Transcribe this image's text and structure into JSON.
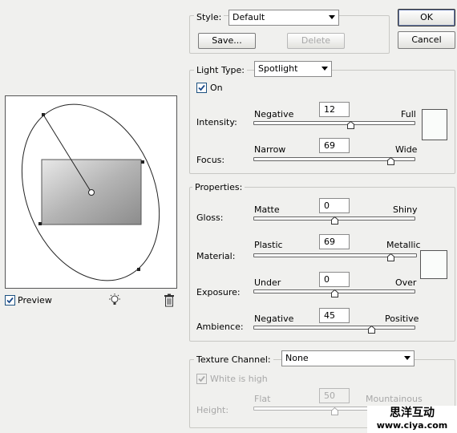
{
  "preview": {
    "checkbox_label": "Preview",
    "checked": true
  },
  "style": {
    "label": "Style:",
    "value": "Default",
    "save_label": "Save...",
    "delete_label": "Delete"
  },
  "dialog": {
    "ok_label": "OK",
    "cancel_label": "Cancel"
  },
  "light": {
    "type_label": "Light Type:",
    "type_value": "Spotlight",
    "on_label": "On",
    "on_checked": true,
    "intensity": {
      "label": "Intensity:",
      "min_label": "Negative",
      "max_label": "Full",
      "value": "12",
      "fraction": 0.6
    },
    "focus": {
      "label": "Focus:",
      "min_label": "Narrow",
      "max_label": "Wide",
      "value": "69",
      "fraction": 0.85
    }
  },
  "properties": {
    "title": "Properties:",
    "gloss": {
      "label": "Gloss:",
      "min_label": "Matte",
      "max_label": "Shiny",
      "value": "0",
      "fraction": 0.5
    },
    "material": {
      "label": "Material:",
      "min_label": "Plastic",
      "max_label": "Metallic",
      "value": "69",
      "fraction": 0.84
    },
    "exposure": {
      "label": "Exposure:",
      "min_label": "Under",
      "max_label": "Over",
      "value": "0",
      "fraction": 0.5
    },
    "ambience": {
      "label": "Ambience:",
      "min_label": "Negative",
      "max_label": "Positive",
      "value": "45",
      "fraction": 0.73
    }
  },
  "texture": {
    "label": "Texture Channel:",
    "value": "None",
    "white_is_high_label": "White is high",
    "white_is_high_checked": true,
    "height": {
      "label": "Height:",
      "min_label": "Flat",
      "max_label": "Mountainous",
      "value": "50"
    }
  },
  "watermark": {
    "line1": "思洋互动",
    "line2": "www.ciya.com"
  },
  "colors": {
    "background": "#f0f0ee",
    "swatch": "#fafcfa"
  },
  "icons": [
    "bulb-icon",
    "trash-icon"
  ]
}
